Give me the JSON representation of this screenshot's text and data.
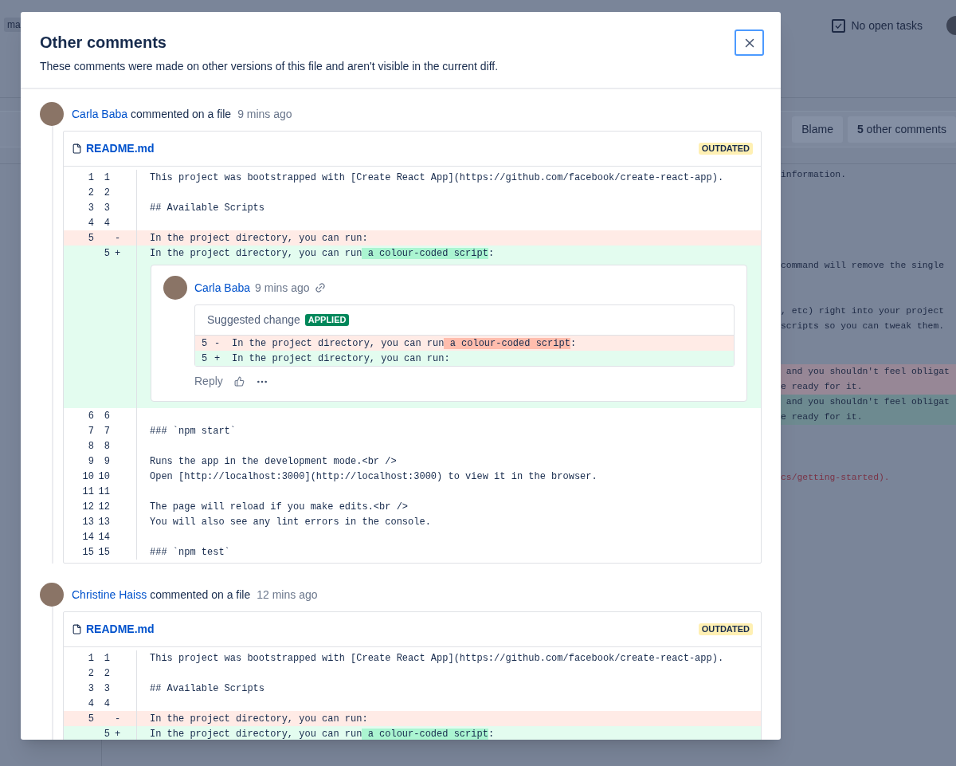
{
  "background": {
    "branch_chip": "ma",
    "tasks": {
      "label": "No open tasks",
      "checked": true
    },
    "buttons": [
      {
        "label": "Blame"
      },
      {
        "label": "**5** other comments"
      }
    ],
    "code_lines": [
      {
        "kind": "context",
        "text": "information."
      },
      {
        "kind": "blank"
      },
      {
        "kind": "blank"
      },
      {
        "kind": "blank"
      },
      {
        "kind": "blank"
      },
      {
        "kind": "blank"
      },
      {
        "kind": "context",
        "text": "command will remove the single"
      },
      {
        "kind": "blank"
      },
      {
        "kind": "blank"
      },
      {
        "kind": "context",
        "text": ", etc) right into your project"
      },
      {
        "kind": "context",
        "text": "scripts so you can tweak them."
      },
      {
        "kind": "blank"
      },
      {
        "kind": "blank"
      },
      {
        "kind": "removed",
        "text": " and you shouldn't feel obligat"
      },
      {
        "kind": "removed",
        "text": "e ready for it."
      },
      {
        "kind": "added",
        "text": " and you shouldn't feel obligat"
      },
      {
        "kind": "added",
        "text": "e ready for it."
      },
      {
        "kind": "blank"
      },
      {
        "kind": "blank"
      },
      {
        "kind": "blank"
      },
      {
        "kind": "link",
        "text": "cs/getting-started)."
      }
    ]
  },
  "modal": {
    "title": "Other comments",
    "description": "These comments were made on other versions of this file and aren't visible in the current diff.",
    "comments": [
      {
        "author": "Carla Baba",
        "action": "commented on a file",
        "time": "9 mins ago",
        "file": {
          "name": "README.md",
          "badge": "OUTDATED"
        },
        "rows": [
          {
            "kind": "context",
            "old": "1",
            "new": "1",
            "text": "This project was bootstrapped with [Create React App](https://github.com/facebook/create-react-app)."
          },
          {
            "kind": "context",
            "old": "2",
            "new": "2"
          },
          {
            "kind": "context",
            "old": "3",
            "new": "3",
            "text": "## Available Scripts"
          },
          {
            "kind": "context",
            "old": "4",
            "new": "4"
          },
          {
            "kind": "removed",
            "old": "5",
            "sign": "-",
            "text": "In the project directory, you can run:"
          },
          {
            "kind": "added",
            "new": "5",
            "sign": "+",
            "text": "In the project directory, you can run",
            "highlight": " a colour-coded script",
            "after": ":",
            "comment": {
              "author": "Carla Baba",
              "time": "9 mins ago",
              "suggestion": {
                "title": "Suggested change",
                "badge": "APPLIED",
                "rows": [
                  {
                    "kind": "removed",
                    "line": "5",
                    "sign": "-",
                    "text": "In the project directory, you can run",
                    "highlight": " a colour-coded script",
                    "after": ":"
                  },
                  {
                    "kind": "added",
                    "line": "5",
                    "sign": "+",
                    "text": "In the project directory, you can run:"
                  }
                ]
              },
              "reply": "Reply"
            }
          },
          {
            "kind": "context",
            "old": "6",
            "new": "6"
          },
          {
            "kind": "context",
            "old": "7",
            "new": "7",
            "text": "### `npm start`"
          },
          {
            "kind": "context",
            "old": "8",
            "new": "8"
          },
          {
            "kind": "context",
            "old": "9",
            "new": "9",
            "text": "Runs the app in the development mode.<br />"
          },
          {
            "kind": "context",
            "old": "10",
            "new": "10",
            "text": "Open [http://localhost:3000](http://localhost:3000) to view it in the browser."
          },
          {
            "kind": "context",
            "old": "11",
            "new": "11"
          },
          {
            "kind": "context",
            "old": "12",
            "new": "12",
            "text": "The page will reload if you make edits.<br />"
          },
          {
            "kind": "context",
            "old": "13",
            "new": "13",
            "text": "You will also see any lint errors in the console."
          },
          {
            "kind": "context",
            "old": "14",
            "new": "14"
          },
          {
            "kind": "context",
            "old": "15",
            "new": "15",
            "text": "### `npm test`"
          }
        ]
      },
      {
        "author": "Christine Haiss",
        "action": "commented on a file",
        "time": "12 mins ago",
        "file": {
          "name": "README.md",
          "badge": "OUTDATED"
        },
        "rows": [
          {
            "kind": "context",
            "old": "1",
            "new": "1",
            "text": "This project was bootstrapped with [Create React App](https://github.com/facebook/create-react-app)."
          },
          {
            "kind": "context",
            "old": "2",
            "new": "2"
          },
          {
            "kind": "context",
            "old": "3",
            "new": "3",
            "text": "## Available Scripts"
          },
          {
            "kind": "context",
            "old": "4",
            "new": "4"
          },
          {
            "kind": "removed",
            "old": "5",
            "sign": "-",
            "text": "In the project directory, you can run:"
          },
          {
            "kind": "added",
            "new": "5",
            "sign": "+",
            "text": "In the project directory, you can run",
            "highlight": " a colour-coded script",
            "after": ":"
          }
        ]
      }
    ]
  }
}
